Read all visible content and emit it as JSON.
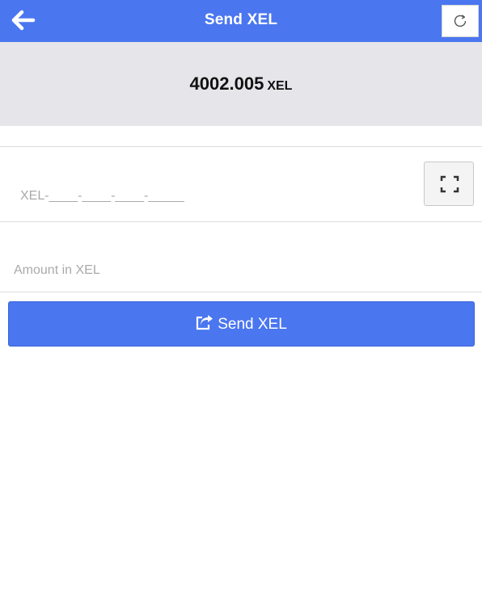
{
  "header": {
    "title": "Send XEL",
    "back_icon": "arrow-left-icon",
    "refresh_icon": "refresh-icon"
  },
  "balance": {
    "amount": "4002.005",
    "unit": "XEL"
  },
  "recipient": {
    "placeholder": "XEL-____-____-____-_____",
    "value": "",
    "scan_icon": "qr-scan-icon"
  },
  "amount": {
    "placeholder": "Amount in XEL",
    "value": ""
  },
  "send_button": {
    "label": "Send XEL",
    "icon": "share-icon"
  },
  "colors": {
    "accent": "#4a76f0",
    "balance_bg": "#e5e5ea"
  }
}
